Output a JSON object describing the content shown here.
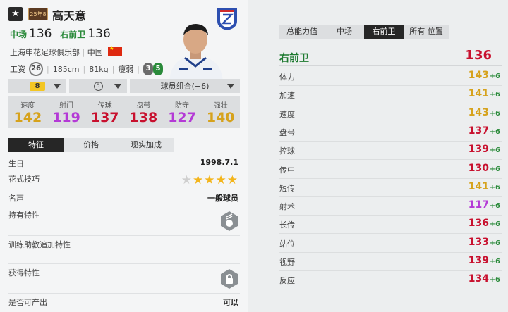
{
  "player": {
    "season_badge": "25年8",
    "name": "高天意",
    "primary_pos": "中场",
    "primary_val": "136",
    "second_pos": "右前卫",
    "second_val": "136",
    "club": "上海申花足球俱乐部",
    "country": "中国",
    "wage_label": "工资",
    "wage": "26",
    "height": "185cm",
    "weight": "81kg",
    "weak_foot": "瘦弱",
    "skill_a": "3",
    "skill_b": "5"
  },
  "selectors": {
    "level": "8",
    "tier": "5",
    "team_combo": "球员组合(+6)"
  },
  "attributes": [
    {
      "label": "速度",
      "value": "142",
      "color": "#d6a21c"
    },
    {
      "label": "射门",
      "value": "119",
      "color": "#b43ad6"
    },
    {
      "label": "传球",
      "value": "137",
      "color": "#c8102e"
    },
    {
      "label": "盘带",
      "value": "138",
      "color": "#c8102e"
    },
    {
      "label": "防守",
      "value": "127",
      "color": "#b43ad6"
    },
    {
      "label": "强壮",
      "value": "140",
      "color": "#d6a21c"
    }
  ],
  "tabs": [
    "特征",
    "价格",
    "现实加成"
  ],
  "traits": {
    "birthday_label": "生日",
    "birthday": "1998.7.1",
    "skill_label": "花式技巧",
    "skill_stars": 4,
    "reputation_label": "名声",
    "reputation": "一般球员",
    "traits_label": "持有特性",
    "coach_label": "训练助教追加特性",
    "acquired_label": "获得特性",
    "producible_label": "是否可产出",
    "producible": "可以"
  },
  "right_tabs": [
    "总能力值",
    "中场",
    "右前卫",
    "所有 位置"
  ],
  "position_title": "右前卫",
  "position_value": "136",
  "stats": [
    {
      "label": "体力",
      "value": "143",
      "bonus": "+6",
      "color": "#d6a21c"
    },
    {
      "label": "加速",
      "value": "141",
      "bonus": "+6",
      "color": "#d6a21c"
    },
    {
      "label": "速度",
      "value": "143",
      "bonus": "+6",
      "color": "#d6a21c"
    },
    {
      "label": "盘带",
      "value": "137",
      "bonus": "+6",
      "color": "#c8102e"
    },
    {
      "label": "控球",
      "value": "139",
      "bonus": "+6",
      "color": "#c8102e"
    },
    {
      "label": "传中",
      "value": "130",
      "bonus": "+6",
      "color": "#c8102e"
    },
    {
      "label": "短传",
      "value": "141",
      "bonus": "+6",
      "color": "#d6a21c"
    },
    {
      "label": "射术",
      "value": "117",
      "bonus": "+6",
      "color": "#b43ad6"
    },
    {
      "label": "长传",
      "value": "136",
      "bonus": "+6",
      "color": "#c8102e"
    },
    {
      "label": "站位",
      "value": "133",
      "bonus": "+6",
      "color": "#c8102e"
    },
    {
      "label": "视野",
      "value": "139",
      "bonus": "+6",
      "color": "#c8102e"
    },
    {
      "label": "反应",
      "value": "134",
      "bonus": "+6",
      "color": "#c8102e"
    }
  ]
}
